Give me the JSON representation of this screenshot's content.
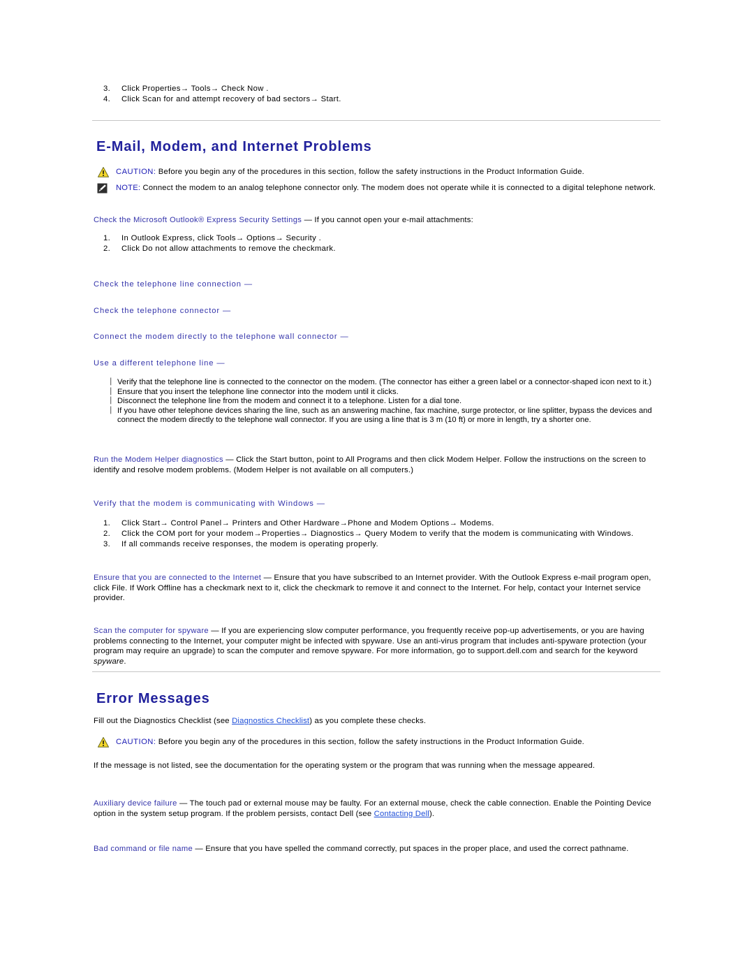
{
  "document": {
    "top_list": {
      "items": [
        {
          "num": "3.",
          "text": "Click Properties→ Tools→ Check Now ."
        },
        {
          "num": "4.",
          "text": "Click Scan for and attempt recovery of bad sectors→ Start."
        }
      ]
    },
    "colors": {
      "heading": "#21219c",
      "subheading": "#3333aa",
      "link": "#1f4fd8",
      "caution_label": "#1b1bb5",
      "caution_icon": "#f2d024",
      "rule": "#c6c6c6"
    },
    "sections": [
      {
        "id": "email-modem-internet",
        "title": "E-Mail, Modem, and Internet Problems",
        "caution": {
          "icon": "warning-triangle-icon",
          "label": "CAUTION:",
          "text": " Before you begin any of the procedures in this section, follow the safety instructions in the Product Information Guide."
        },
        "note": {
          "icon": "note-pencil-icon",
          "label": "NOTE:",
          "text": " Connect the modem to an analog telephone connector only. The modem does not operate while it is connected to a digital telephone network."
        },
        "outlook": {
          "heading": "Check the Microsoft Outlook® Express Security Settings",
          "dash": " — ",
          "lead": "If you cannot open your e-mail attachments:",
          "items": [
            {
              "num": "1.",
              "text": "In Outlook Express, click Tools→ Options→ Security ."
            },
            {
              "num": "2.",
              "text": "Click Do not allow attachments to remove the checkmark."
            }
          ]
        },
        "short_headings": [
          "Check the telephone line connection —",
          "Check the telephone connector —",
          "Connect the modem directly to the telephone wall connector —",
          "Use a different telephone line —"
        ],
        "bullets": [
          "Verify that the telephone line is connected to the connector on the modem. (The connector has either a green label or a connector-shaped icon next to it.)",
          "Ensure that you insert the telephone line connector into the modem until it clicks.",
          "Disconnect the telephone line from the modem and connect it to a telephone. Listen for a dial tone.",
          "If you have other telephone devices sharing the line, such as an answering machine, fax machine, surge protector, or line splitter, bypass the devices and connect the modem directly to the telephone wall connector. If you are using a line that is 3 m (10 ft) or more in length, try a shorter one."
        ],
        "modem_helper": {
          "heading": "Run the Modem Helper diagnostics",
          "dash": " — ",
          "text": "Click the Start button, point to All Programs and then click Modem Helper. Follow the instructions on the screen to identify and resolve modem problems. (Modem Helper is not available on all computers.)"
        },
        "verify_modem": {
          "heading": "Verify that the modem is communicating with Windows —",
          "items": [
            {
              "num": "1.",
              "text": "Click Start→ Control Panel→ Printers and Other Hardware→Phone and Modem Options→ Modems."
            },
            {
              "num": "2.",
              "text": "Click the COM port for your modem→Properties→ Diagnostics→ Query Modem to verify that the modem is communicating with Windows."
            },
            {
              "num": "3.",
              "text": "If all commands receive responses, the modem is operating properly."
            }
          ]
        },
        "internet_connected": {
          "heading": "Ensure that you are connected to the Internet",
          "dash": " — ",
          "text": "Ensure that you have subscribed to an Internet provider. With the Outlook Express e-mail program open, click File. If Work Offline has a checkmark next to it, click the checkmark to remove it and connect to the Internet. For help, contact your Internet service provider."
        },
        "spyware": {
          "heading": "Scan the computer for spyware",
          "dash": " — ",
          "text_before": "If you are experiencing slow computer performance, you frequently receive pop-up advertisements, or you are having problems connecting to the Internet, your computer might be infected with spyware. Use an anti-virus program that includes anti-spyware protection (your program may require an upgrade) to scan the computer and remove spyware. For more information, go to support.dell.com and search for the keyword ",
          "keyword": "spyware",
          "text_after": "."
        }
      },
      {
        "id": "error-messages",
        "title": "Error Messages",
        "intro_before": "Fill out the Diagnostics Checklist (see ",
        "intro_link": "Diagnostics Checklist",
        "intro_after": ") as you complete these checks.",
        "caution": {
          "icon": "warning-triangle-icon",
          "label": "CAUTION:",
          "text": " Before you begin any of the procedures in this section, follow the safety instructions in the Product Information Guide."
        },
        "not_listed": "If the message is not listed, see the documentation for the operating system or the program that was running when the message appeared.",
        "aux_device": {
          "heading": "Auxiliary device failure",
          "dash": " — ",
          "text_before": "The touch pad or external mouse may be faulty. For an external mouse, check the cable connection. Enable the Pointing Device option in the system setup program. If the problem persists, contact Dell (see ",
          "link": "Contacting Dell",
          "text_after": ")."
        },
        "bad_command": {
          "heading": "Bad command or file name",
          "dash": " — ",
          "text": "Ensure that you have spelled the command correctly, put spaces in the proper place, and used the correct pathname."
        }
      }
    ]
  }
}
